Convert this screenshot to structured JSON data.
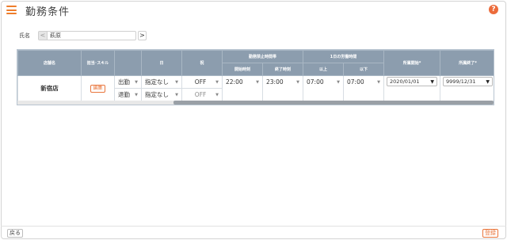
{
  "header": {
    "title": "勤務条件",
    "menu_icon": "hamburger-icon",
    "help_icon": "help-icon",
    "help_symbol": "?"
  },
  "employee": {
    "label": "氏名",
    "value": "萩原",
    "prev_symbol": "<",
    "next_symbol": ">"
  },
  "table": {
    "headers": {
      "store": "店舗名",
      "skill": "担当･スキル",
      "blank": "",
      "day": "日",
      "holiday": "祝",
      "prohibited_group": "勤務禁止時間帯",
      "start_time": "開始時刻",
      "end_time": "終了時刻",
      "daily_group": "1日の労働時間",
      "min": "以上",
      "max": "以下",
      "belong_start": "所属開始*",
      "belong_end": "所属終了*"
    },
    "row": {
      "store": "新宿店",
      "edit_label": "編集",
      "clock_in": "出勤",
      "clock_out": "退勤",
      "day_in": "指定なし",
      "day_out": "指定なし",
      "holiday_in": "OFF",
      "holiday_out": "OFF",
      "start_time": "22:00",
      "end_time": "23:00",
      "min_hours": "07:00",
      "max_hours": "07:00",
      "belong_start": "2020/01/01",
      "belong_end": "9999/12/31"
    }
  },
  "footer": {
    "back_label": "戻る",
    "register_label": "登録"
  },
  "colors": {
    "accent": "#ee7d2b",
    "header_bg": "#8c9dae",
    "disabled_bg": "#c9c9c9"
  }
}
